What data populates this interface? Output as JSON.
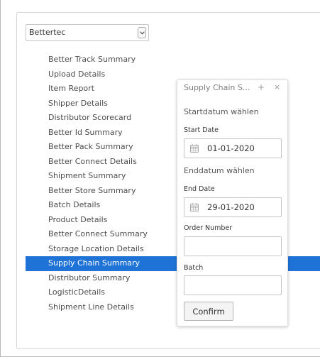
{
  "company_select": {
    "value": "Bettertec"
  },
  "reports": [
    "Better Track Summary",
    "Upload Details",
    "Item Report",
    "Shipper Details",
    "Distributor Scorecard",
    "Better Id Summary",
    "Better Pack Summary",
    "Better Connect Details",
    "Shipment Summary",
    "Better Store Summary",
    "Batch Details",
    "Product Details",
    "Better Connect Summary",
    "Storage Location Details",
    "Supply Chain Summary",
    "Distributor Summary",
    "LogisticDetails",
    "Shipment Line Details"
  ],
  "selected_report": "Supply Chain Summary",
  "dialog": {
    "title": "Supply Chain S...",
    "plus": "+",
    "close": "×",
    "start_section": "Startdatum wählen",
    "start_label": "Start Date",
    "start_value": "01-01-2020",
    "end_section": "Enddatum wählen",
    "end_label": "End Date",
    "end_value": "29-01-2020",
    "order_label": "Order Number",
    "order_value": "",
    "batch_label": "Batch",
    "batch_value": "",
    "confirm_label": "Confirm"
  },
  "icons": {
    "calendar": "calendar-icon",
    "dropdown": "chevron-down-icon"
  },
  "colors": {
    "selection": "#1f73d6",
    "selection_text": "#ffffff",
    "list_text": "#4d4d4d"
  }
}
